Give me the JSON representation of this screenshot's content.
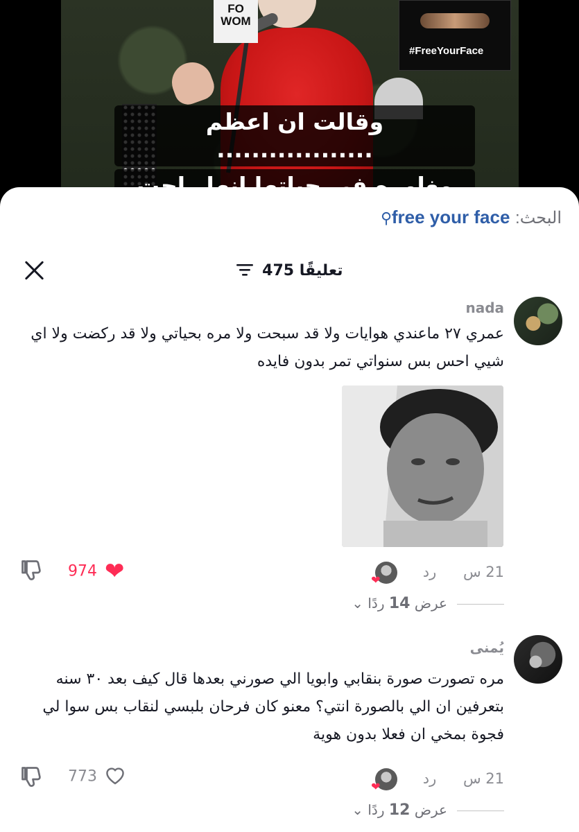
{
  "video": {
    "sign_left_text": "FO\nWOM",
    "sign_right_text": "#FreeYourFace",
    "caption_line1": "وقالت ان اعظم ..................",
    "caption_line2": "مغامره في حياتها انها راحت مقهى !"
  },
  "search": {
    "label": "البحث:",
    "term": "free your face",
    "icon": "search-icon"
  },
  "header": {
    "comment_count_label": "475 تعليقًا",
    "close_icon": "close-icon",
    "filter_icon": "filter-icon"
  },
  "colors": {
    "accent_like": "#fe2c55",
    "search_blue": "#2f5ea8",
    "muted_text": "#8a8b91"
  },
  "comments": [
    {
      "username": "nada",
      "text": "عمري ٢٧ ماعندي هوايات ولا قد سبحت ولا مره بحياتي ولا قد ركضت ولا اي شيي احس بس سنواتي تمر بدون فايده",
      "has_image": true,
      "time": "21 س",
      "reply_label": "رد",
      "likes": "974",
      "liked": true,
      "view_replies_prefix": "عرض",
      "view_replies_count": "14",
      "view_replies_suffix": "ردًا"
    },
    {
      "username": "يُمنى",
      "text": "مره تصورت صورة بنقابي وابويا الي صورني بعدها قال كيف بعد ٣٠ سنه بتعرفين ان الي بالصورة انتي؟ معنو كان فرحان بلبسي لنقاب بس سوا لي فجوة بمخي ان فعلا بدون هوية",
      "has_image": false,
      "time": "21 س",
      "reply_label": "رد",
      "likes": "773",
      "liked": false,
      "view_replies_prefix": "عرض",
      "view_replies_count": "12",
      "view_replies_suffix": "ردًا"
    }
  ]
}
